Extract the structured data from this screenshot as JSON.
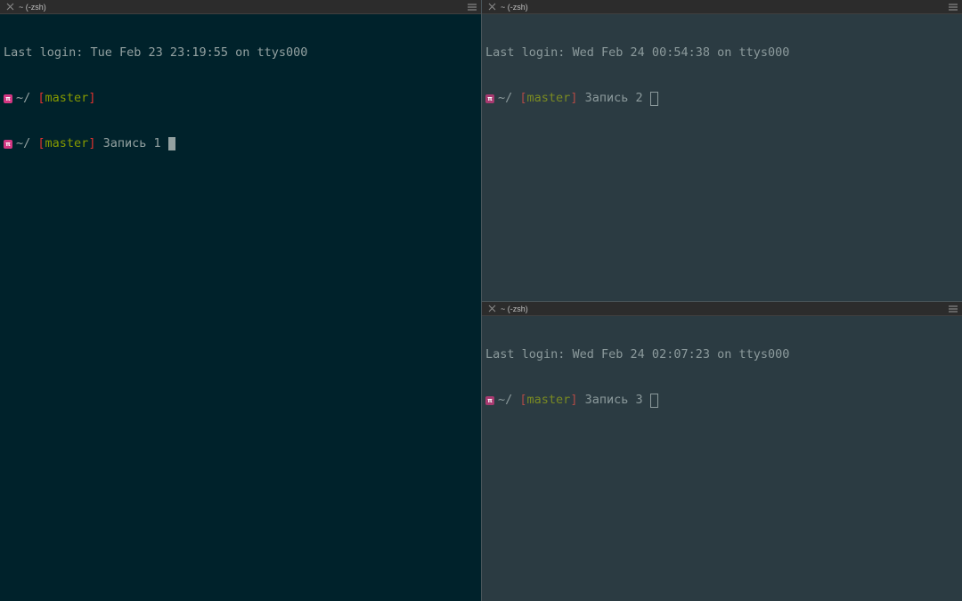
{
  "panes": [
    {
      "tab_title": "~ (-zsh)",
      "last_login": "Last login: Tue Feb 23 23:19:55 on ttys000",
      "prompt_lines": [
        {
          "dir": "~/",
          "branch_open": "[",
          "branch": "master",
          "branch_close": "]",
          "command": ""
        },
        {
          "dir": "~/",
          "branch_open": "[",
          "branch": "master",
          "branch_close": "]",
          "command": "Запись 1"
        }
      ]
    },
    {
      "tab_title": "~ (-zsh)",
      "last_login": "Last login: Wed Feb 24 00:54:38 on ttys000",
      "prompt_lines": [
        {
          "dir": "~/",
          "branch_open": "[",
          "branch": "master",
          "branch_close": "]",
          "command": "Запись 2"
        }
      ]
    },
    {
      "tab_title": "~ (-zsh)",
      "last_login": "Last login: Wed Feb 24 02:07:23 on ttys000",
      "prompt_lines": [
        {
          "dir": "~/",
          "branch_open": "[",
          "branch": "master",
          "branch_close": "]",
          "command": "Запись 3"
        }
      ]
    }
  ],
  "icons": {
    "close": "close-icon",
    "menu": "hamburger-menu-icon",
    "prompt": "prompt-badge-icon"
  },
  "colors": {
    "active_bg": "#00222b",
    "inactive_bg": "#2b3b42",
    "branch": "#859900",
    "bracket": "#dc322f",
    "prompt_badge": "#d33682"
  }
}
